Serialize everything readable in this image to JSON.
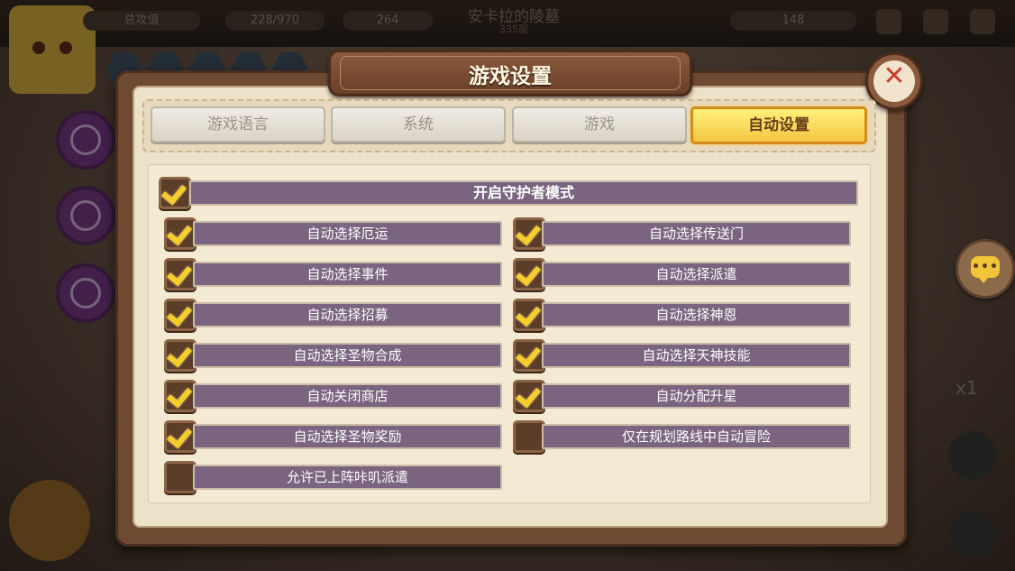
{
  "background": {
    "pill_left": "总攻值",
    "resource_1": "228/970",
    "resource_2": "264",
    "map_title": "安卡拉的陵墓",
    "map_subtitle": "335层",
    "right_count": "148",
    "speed_label": "x1"
  },
  "dialog": {
    "title": "游戏设置",
    "close_icon": "close-icon"
  },
  "tabs": [
    {
      "label": "游戏语言",
      "active": false
    },
    {
      "label": "系统",
      "active": false
    },
    {
      "label": "游戏",
      "active": false
    },
    {
      "label": "自动设置",
      "active": true
    }
  ],
  "settings": {
    "main": {
      "label": "开启守护者模式",
      "checked": true
    },
    "left": [
      {
        "label": "自动选择厄运",
        "checked": true
      },
      {
        "label": "自动选择事件",
        "checked": true
      },
      {
        "label": "自动选择招募",
        "checked": true
      },
      {
        "label": "自动选择圣物合成",
        "checked": true
      },
      {
        "label": "自动关闭商店",
        "checked": true
      },
      {
        "label": "自动选择圣物奖励",
        "checked": true
      },
      {
        "label": "允许已上阵咔叽派遣",
        "checked": false
      }
    ],
    "right": [
      {
        "label": "自动选择传送门",
        "checked": true
      },
      {
        "label": "自动选择派遣",
        "checked": true
      },
      {
        "label": "自动选择神恩",
        "checked": true
      },
      {
        "label": "自动选择天神技能",
        "checked": true
      },
      {
        "label": "自动分配升星",
        "checked": true
      },
      {
        "label": "仅在规划路线中自动冒险",
        "checked": false
      }
    ]
  },
  "chat": {
    "icon": "chat-bubble-icon",
    "dots": "•••"
  }
}
